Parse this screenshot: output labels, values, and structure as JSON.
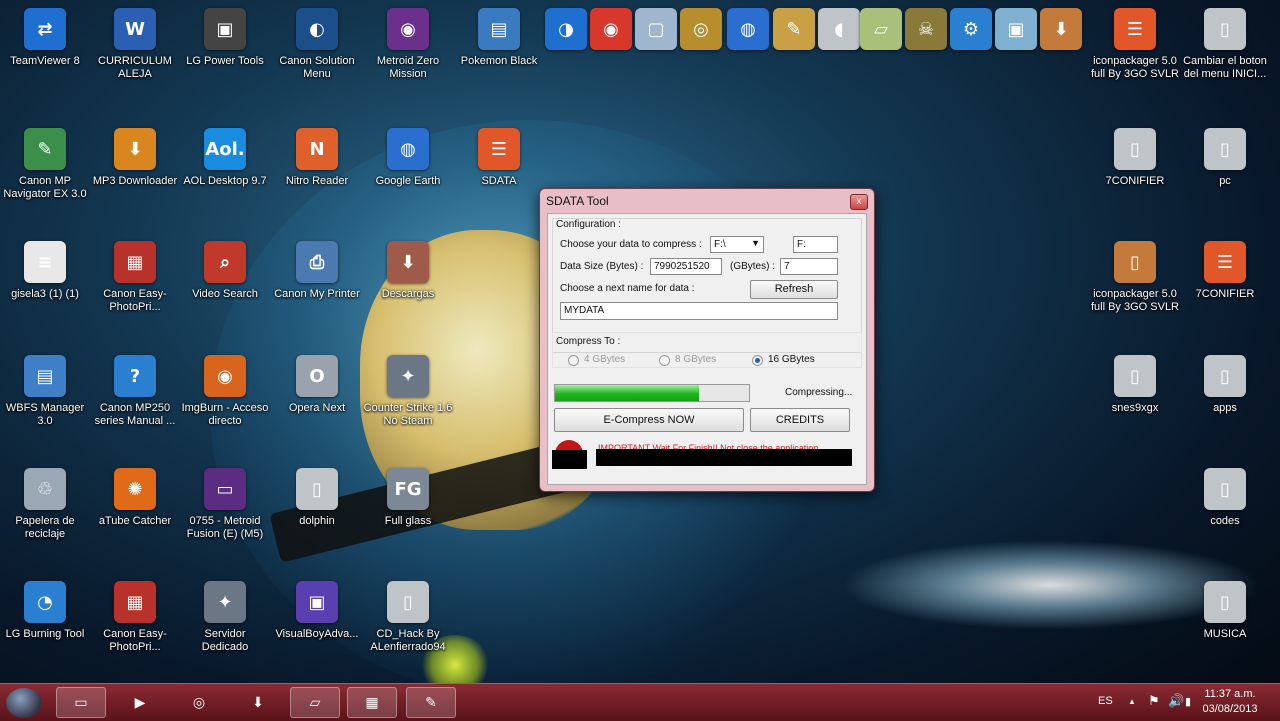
{
  "desktop": {
    "icons": [
      {
        "label": "TeamViewer 8",
        "glyph": "⇄",
        "color": "#1f6fd1"
      },
      {
        "label": "CURRICULUM ALEJA",
        "glyph": "W",
        "color": "#2b5fb3"
      },
      {
        "label": "LG Power Tools",
        "glyph": "▣",
        "color": "#444444"
      },
      {
        "label": "Canon Solution Menu",
        "glyph": "◐",
        "color": "#1c4f8a"
      },
      {
        "label": "Metroid Zero Mission",
        "glyph": "◉",
        "color": "#6b2f8c"
      },
      {
        "label": "Pokemon Black",
        "glyph": "▤",
        "color": "#3a7bbf"
      },
      {
        "label": "iconpackager 5.0 full By 3GO SVLR",
        "glyph": "☰",
        "color": "#e2572a"
      },
      {
        "label": "Cambiar el boton del menu INICI...",
        "glyph": "▯",
        "color": "#bfc4c8"
      },
      {
        "label": "Canon MP Navigator EX 3.0",
        "glyph": "✎",
        "color": "#3b8f4a"
      },
      {
        "label": "MP3 Downloader",
        "glyph": "⬇",
        "color": "#d9861e"
      },
      {
        "label": "AOL Desktop 9.7",
        "glyph": "Aol.",
        "color": "#1a8ce0"
      },
      {
        "label": "Nitro Reader",
        "glyph": "N",
        "color": "#e0602c"
      },
      {
        "label": "Google Earth",
        "glyph": "◍",
        "color": "#2a6fd0"
      },
      {
        "label": "SDATA",
        "glyph": "☰",
        "color": "#e2572a"
      },
      {
        "label": "7CONIFIER",
        "glyph": "▯",
        "color": "#bfc4c8"
      },
      {
        "label": "pc",
        "glyph": "▯",
        "color": "#bfc4c8"
      },
      {
        "label": "gisela3 (1) (1)",
        "glyph": "≡",
        "color": "#e8e8e8"
      },
      {
        "label": "Canon Easy-PhotoPri...",
        "glyph": "▦",
        "color": "#b8322b"
      },
      {
        "label": "Video Search",
        "glyph": "⌕",
        "color": "#c0392b"
      },
      {
        "label": "Canon My Printer",
        "glyph": "⎙",
        "color": "#4a7ab0"
      },
      {
        "label": "Descargas",
        "glyph": "⬇",
        "color": "#a05a4a"
      },
      {
        "label": "iconpackager 5.0 full By 3GO SVLR",
        "glyph": "▯",
        "color": "#c47a3a"
      },
      {
        "label": "7CONIFIER",
        "glyph": "☰",
        "color": "#e2572a"
      },
      {
        "label": "WBFS Manager 3.0",
        "glyph": "▤",
        "color": "#3f7fc8"
      },
      {
        "label": "Canon MP250 series Manual ...",
        "glyph": "?",
        "color": "#2a7fd0"
      },
      {
        "label": "ImgBurn - Acceso directo",
        "glyph": "◉",
        "color": "#d9641e"
      },
      {
        "label": "Opera Next",
        "glyph": "O",
        "color": "#9aa3ad"
      },
      {
        "label": "Counter Strike 1.6 No Steam",
        "glyph": "✦",
        "color": "#6b7785"
      },
      {
        "label": "snes9xgx",
        "glyph": "▯",
        "color": "#bfc4c8"
      },
      {
        "label": "apps",
        "glyph": "▯",
        "color": "#bfc4c8"
      },
      {
        "label": "Papelera de reciclaje",
        "glyph": "♲",
        "color": "#9aa7b5"
      },
      {
        "label": "aTube Catcher",
        "glyph": "✺",
        "color": "#e06a18"
      },
      {
        "label": "0755 - Metroid Fusion (E) (M5)",
        "glyph": "▭",
        "color": "#5a2d82"
      },
      {
        "label": "dolphin",
        "glyph": "▯",
        "color": "#bfc4c8"
      },
      {
        "label": "Full glass",
        "glyph": "FG",
        "color": "#7c8896"
      },
      {
        "label": "codes",
        "glyph": "▯",
        "color": "#bfc4c8"
      },
      {
        "label": "LG Burning Tool",
        "glyph": "◔",
        "color": "#2a7fd0"
      },
      {
        "label": "Canon Easy-PhotoPri...",
        "glyph": "▦",
        "color": "#b8322b"
      },
      {
        "label": "Servidor Dedicado",
        "glyph": "✦",
        "color": "#6b7785"
      },
      {
        "label": "VisualBoyAdva...",
        "glyph": "▣",
        "color": "#5a3fb0"
      },
      {
        "label": "CD_Hack By ALenfierrado94",
        "glyph": "▯",
        "color": "#bfc4c8"
      },
      {
        "label": "MUSICA",
        "glyph": "▯",
        "color": "#bfc4c8"
      }
    ],
    "top_extra_icons": [
      {
        "glyph": "◑",
        "color": "#1f6fd1"
      },
      {
        "glyph": "◉",
        "color": "#d8382c"
      },
      {
        "glyph": "▢",
        "color": "#9fb6cf"
      },
      {
        "glyph": "◎",
        "color": "#b78d2e"
      },
      {
        "glyph": "◍",
        "color": "#2a6fd0"
      },
      {
        "glyph": "✎",
        "color": "#c9a044"
      },
      {
        "glyph": "◖",
        "color": "#bfc4c8"
      },
      {
        "glyph": "▱",
        "color": "#a9c07a"
      },
      {
        "glyph": "☠",
        "color": "#8a7a3a"
      },
      {
        "glyph": "⚙",
        "color": "#2a7fd0"
      },
      {
        "glyph": "▣",
        "color": "#7fb0d0"
      },
      {
        "glyph": "⬇",
        "color": "#c47a3a"
      }
    ]
  },
  "dialog": {
    "title": "SDATA Tool",
    "close_glyph": "x",
    "configuration_label": "Configuration :",
    "choose_data_label": "Choose your data to compress :",
    "drive_selected": "F:\\",
    "drive_text": "F:",
    "data_size_label": "Data Size (Bytes) :",
    "data_size_value": "7990251520",
    "gbytes_label": "(GBytes) :",
    "gbytes_value": "7",
    "next_name_label": "Choose a next name for data :",
    "refresh_label": "Refresh",
    "name_value": "MYDATA",
    "compress_to_label": "Compress To :",
    "options": [
      "4 GBytes",
      "8 GBytes",
      "16 GBytes"
    ],
    "selected_option": "16 GBytes",
    "progress_fraction": 0.74,
    "status_text": "Compressing...",
    "ecompress_label": "E-Compress NOW",
    "credits_label": "CREDITS",
    "warning_text": "IMPORTANT Wait For Finish!! Not close the application"
  },
  "taskbar": {
    "language": "ES",
    "time": "11:37 a.m.",
    "date": "03/08/2013",
    "up_arrow": "▲",
    "flag_glyph": "⚑",
    "volume_glyph": "🔊",
    "signal_glyph": "▮",
    "buttons": [
      {
        "name": "explorer",
        "glyph": "▭"
      },
      {
        "name": "media-player",
        "glyph": "▶"
      },
      {
        "name": "disc-tool",
        "glyph": "◎"
      },
      {
        "name": "mp3-downloader",
        "glyph": "⬇"
      },
      {
        "name": "notes",
        "glyph": "▱"
      },
      {
        "name": "film",
        "glyph": "▦"
      },
      {
        "name": "sdata",
        "glyph": "✎"
      }
    ]
  }
}
